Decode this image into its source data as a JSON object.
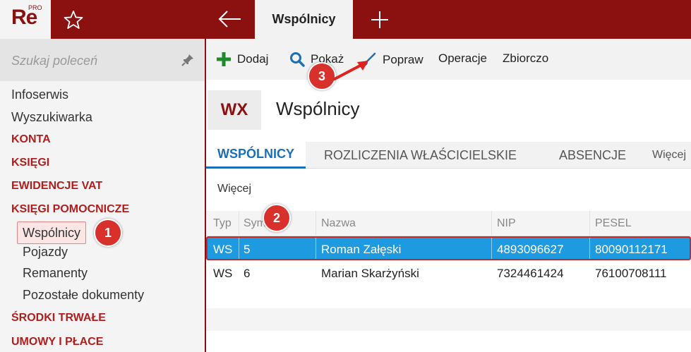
{
  "logo": {
    "text": "Re",
    "badge": "PRO"
  },
  "topbar": {
    "active_tab": "Wspólnicy"
  },
  "sidebar": {
    "search_placeholder": "Szukaj poleceń",
    "items": {
      "infoserwis": "Infoserwis",
      "wyszukiwarka": "Wyszukiwarka",
      "konta": "KONTA",
      "ksiegi": "KSIĘGI",
      "ewidencje": "EWIDENCJE VAT",
      "ksiegi_pom": "KSIĘGI POMOCNICZE",
      "wspolnicy": "Wspólnicy",
      "pojazdy": "Pojazdy",
      "remanenty": "Remanenty",
      "pozostale": "Pozostałe dokumenty",
      "srodki": "ŚRODKI TRWAŁE",
      "umowy": "UMOWY I PŁACE"
    }
  },
  "toolbar": {
    "add": "Dodaj",
    "show": "Pokaż",
    "edit": "Popraw",
    "operations": "Operacje",
    "summary": "Zbiorczo"
  },
  "header": {
    "badge": "WX",
    "title": "Wspólnicy"
  },
  "tabs": {
    "t1": "WSPÓLNICY",
    "t2": "ROZLICZENIA WŁAŚCICIELSKIE",
    "t3": "ABSENCJE",
    "t4": "Więcej"
  },
  "more_link": "Więcej",
  "table": {
    "headers": {
      "typ": "Typ",
      "symbol": "Sym",
      "nazwa": "Nazwa",
      "nip": "NIP",
      "pesel": "PESEL"
    },
    "rows": [
      {
        "typ": "WS",
        "symbol": "5",
        "nazwa": "Roman Załęski",
        "nip": "4893096627",
        "pesel": "80090112171"
      },
      {
        "typ": "WS",
        "symbol": "6",
        "nazwa": "Marian Skarżyński",
        "nip": "7324461424",
        "pesel": "76100708111"
      }
    ]
  },
  "callouts": {
    "c1": "1",
    "c2": "2",
    "c3": "3"
  },
  "colors": {
    "brand": "#8b1111",
    "selection": "#1e9be0",
    "accent_blue": "#1a6fb5",
    "callout": "#d8302b"
  },
  "icons": [
    "star-icon",
    "back-arrow-icon",
    "plus-icon",
    "pin-icon",
    "add-icon",
    "search-icon",
    "brush-icon"
  ]
}
